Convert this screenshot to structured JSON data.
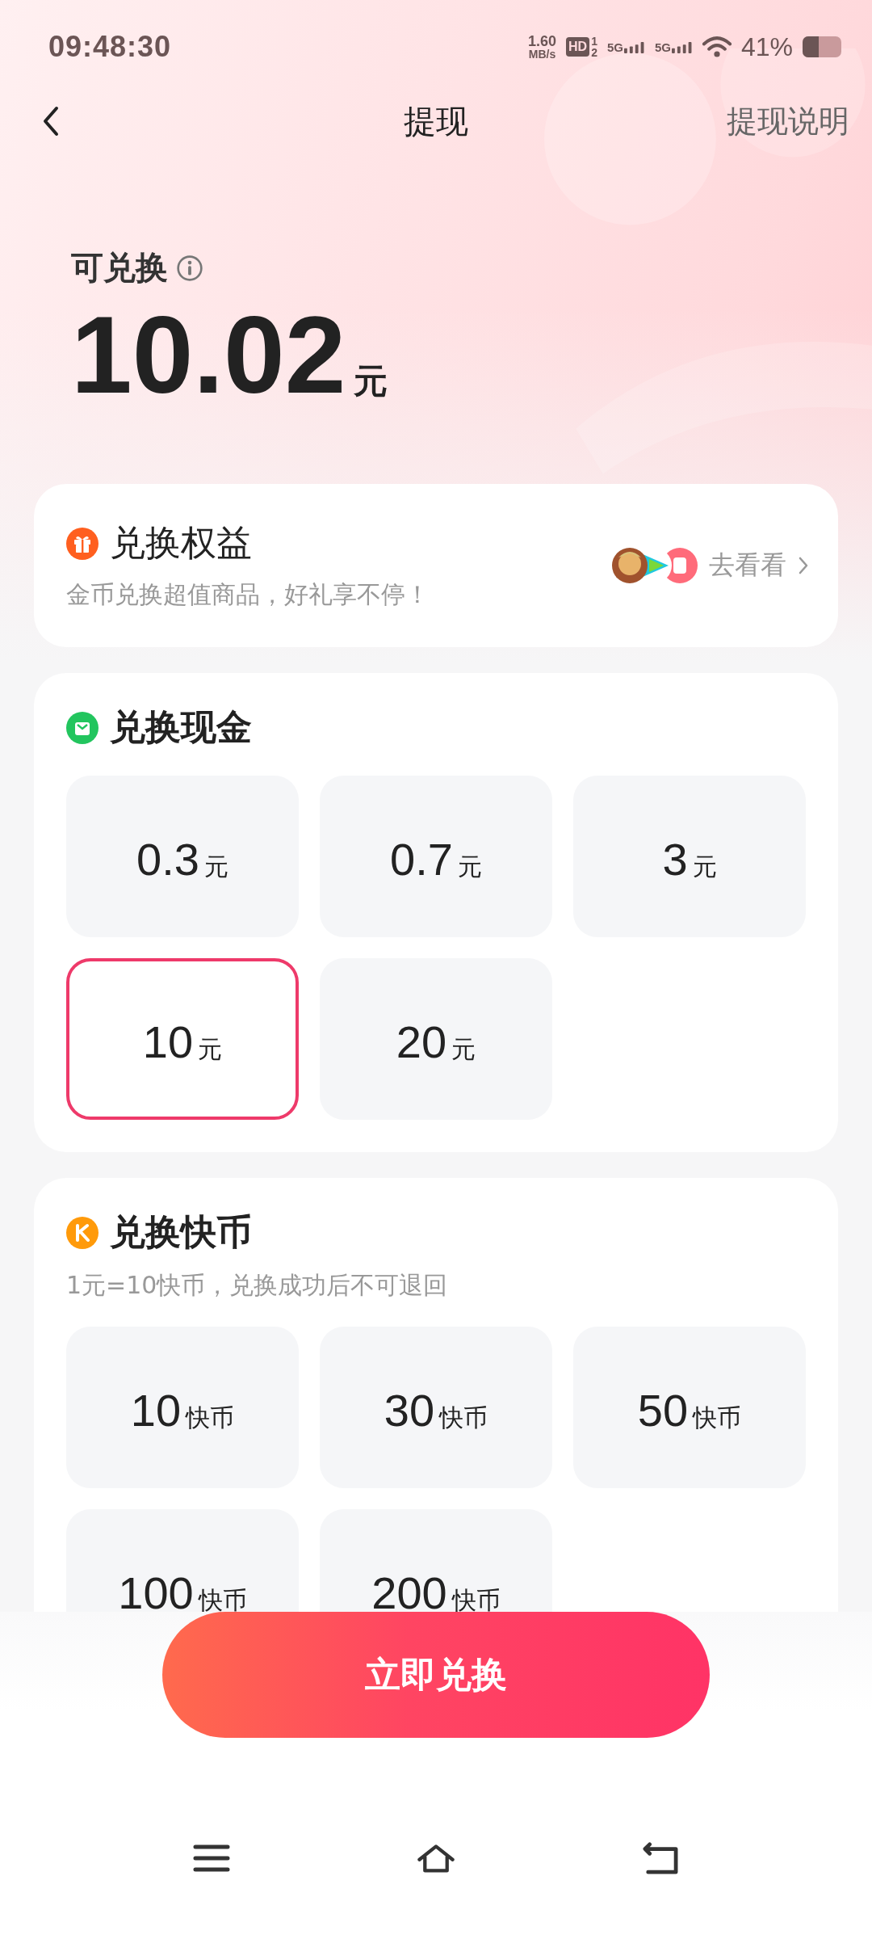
{
  "status_bar": {
    "time": "09:48:30",
    "net_speed": "1.60",
    "net_unit": "MB/s",
    "hd_label": "HD",
    "hd_sims": [
      "1",
      "2"
    ],
    "signals": [
      "5G",
      "5G"
    ],
    "battery": "41%"
  },
  "header": {
    "title": "提现",
    "action": "提现说明"
  },
  "balance": {
    "label": "可兑换",
    "amount": "10.02",
    "unit": "元"
  },
  "benefits": {
    "title": "兑换权益",
    "subtitle": "金币兑换超值商品，好礼享不停！",
    "link": "去看看"
  },
  "cash": {
    "title": "兑换现金",
    "options": [
      {
        "value": "0.3",
        "unit": "元",
        "selected": false
      },
      {
        "value": "0.7",
        "unit": "元",
        "selected": false
      },
      {
        "value": "3",
        "unit": "元",
        "selected": false
      },
      {
        "value": "10",
        "unit": "元",
        "selected": true
      },
      {
        "value": "20",
        "unit": "元",
        "selected": false
      }
    ]
  },
  "coins": {
    "title": "兑换快币",
    "subtitle": "1元=10快币，兑换成功后不可退回",
    "options": [
      {
        "value": "10",
        "unit": "快币",
        "selected": false
      },
      {
        "value": "30",
        "unit": "快币",
        "selected": false
      },
      {
        "value": "50",
        "unit": "快币",
        "selected": false
      },
      {
        "value": "100",
        "unit": "快币",
        "selected": false
      },
      {
        "value": "200",
        "unit": "快币",
        "selected": false
      }
    ]
  },
  "submit": {
    "label": "立即兑换"
  }
}
